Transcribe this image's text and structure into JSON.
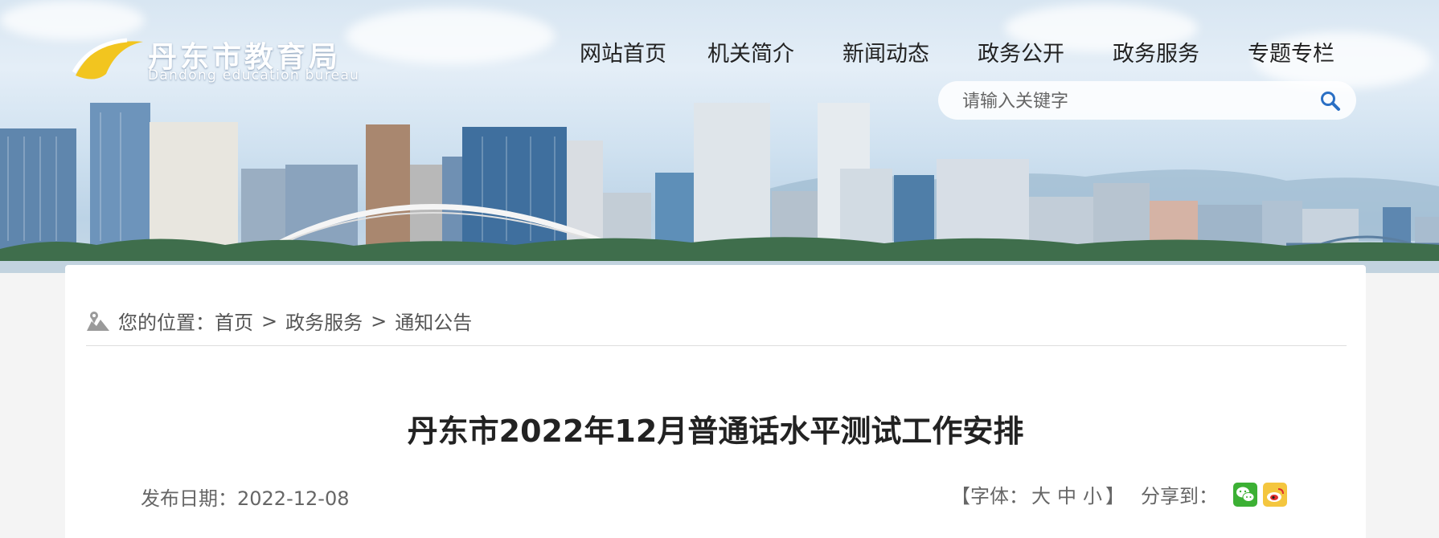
{
  "header": {
    "logo_cn": "丹东市教育局",
    "logo_en": "Dandong education bureau",
    "nav": [
      "网站首页",
      "机关简介",
      "新闻动态",
      "政务公开",
      "政务服务",
      "专题专栏"
    ],
    "search_placeholder": "请输入关键字"
  },
  "breadcrumb": {
    "prefix": "您的位置：",
    "items": [
      "首页",
      "政务服务",
      "通知公告"
    ],
    "separator": ">"
  },
  "article": {
    "title": "丹东市2022年12月普通话水平测试工作安排",
    "date_label": "发布日期：",
    "date": "2022-12-08",
    "font_size_label": "【字体：",
    "font_sizes": [
      "大",
      "中",
      "小"
    ],
    "font_size_close": "】",
    "share_label": "分享到："
  },
  "icons": {
    "breadcrumb": "map-pin-icon",
    "search": "search-icon",
    "wechat": "wechat-icon",
    "weibo": "weibo-icon"
  },
  "colors": {
    "wechat": "#3cb034",
    "weibo": "#f4c63f",
    "logo_accent": "#f2c51f"
  }
}
